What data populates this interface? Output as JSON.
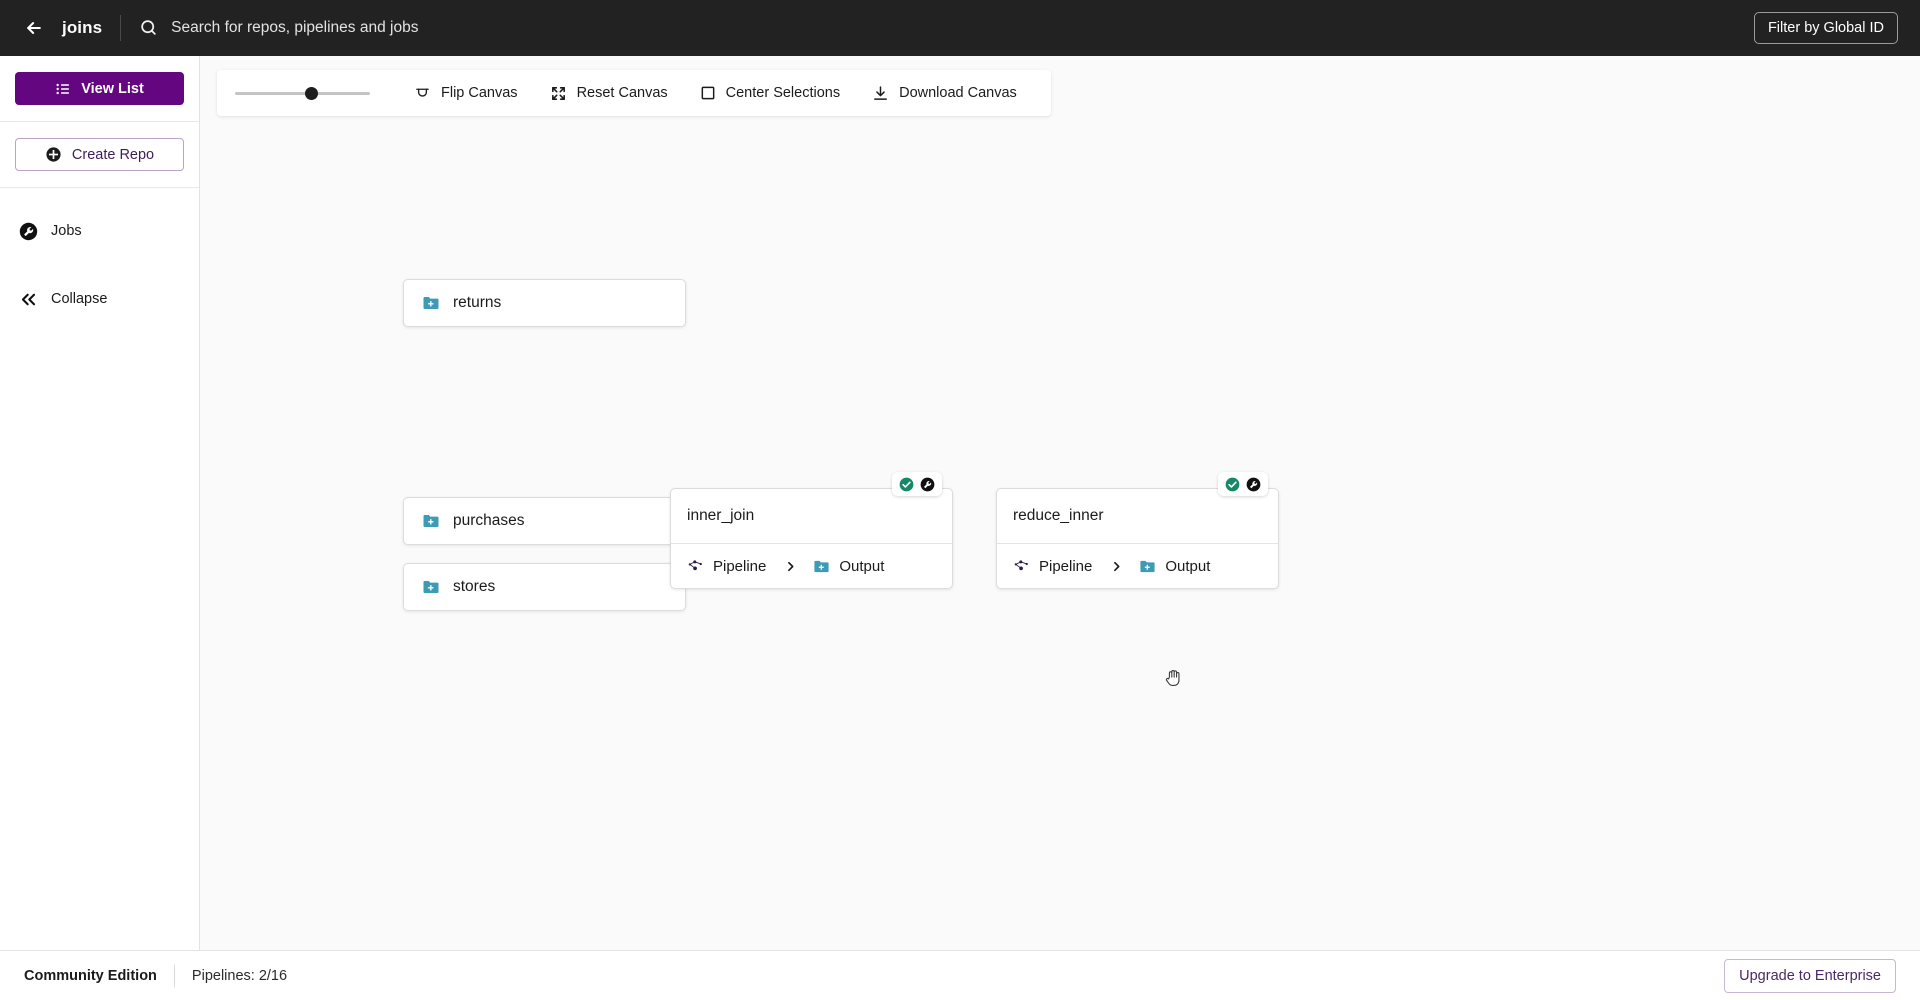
{
  "header": {
    "back_icon": "arrow-left-icon",
    "title": "joins",
    "search": {
      "icon": "search-icon",
      "placeholder": "Search for repos, pipelines and jobs",
      "value": ""
    },
    "filter_button": "Filter by Global ID"
  },
  "sidebar": {
    "view_list": {
      "label": "View List",
      "icon": "list-icon"
    },
    "create_repo": {
      "label": "Create Repo",
      "icon": "plus-circle-icon"
    },
    "nav": [
      {
        "label": "Jobs",
        "icon": "jobs-icon"
      },
      {
        "label": "Collapse",
        "icon": "chevrons-left-icon"
      }
    ]
  },
  "toolbar": {
    "zoom_slider": {
      "value": 57,
      "min": 0,
      "max": 100
    },
    "buttons": [
      {
        "label": "Flip Canvas",
        "icon": "flip-icon"
      },
      {
        "label": "Reset Canvas",
        "icon": "expand-icon"
      },
      {
        "label": "Center Selections",
        "icon": "square-icon"
      },
      {
        "label": "Download Canvas",
        "icon": "download-icon"
      }
    ]
  },
  "canvas": {
    "cursor": "grab-hand-cursor",
    "repos": [
      {
        "name": "returns",
        "icon": "repo-folder-icon"
      },
      {
        "name": "purchases",
        "icon": "repo-folder-icon"
      },
      {
        "name": "stores",
        "icon": "repo-folder-icon"
      }
    ],
    "pipelines": [
      {
        "name": "inner_join",
        "pipeline_label": "Pipeline",
        "pipeline_icon": "pipeline-graph-icon",
        "chevron_icon": "chevron-right-icon",
        "output_label": "Output",
        "output_icon": "repo-folder-icon",
        "badges": [
          {
            "icon": "status-success-icon",
            "state": "success"
          },
          {
            "icon": "jobs-icon",
            "state": "jobs"
          }
        ]
      },
      {
        "name": "reduce_inner",
        "pipeline_label": "Pipeline",
        "pipeline_icon": "pipeline-graph-icon",
        "chevron_icon": "chevron-right-icon",
        "output_label": "Output",
        "output_icon": "repo-folder-icon",
        "badges": [
          {
            "icon": "status-success-icon",
            "state": "success"
          },
          {
            "icon": "jobs-icon",
            "state": "jobs"
          }
        ]
      }
    ]
  },
  "footer": {
    "edition": "Community Edition",
    "pipelines_count": "Pipelines: 2/16",
    "upgrade_button": "Upgrade to Enterprise"
  },
  "colors": {
    "header_bg": "#222222",
    "brand_purple": "#63067f",
    "repo_teal": "#3d9bb5",
    "success_green": "#17876a",
    "canvas_bg": "#fafafa",
    "pipeline_icon": "#2b1a4d"
  }
}
